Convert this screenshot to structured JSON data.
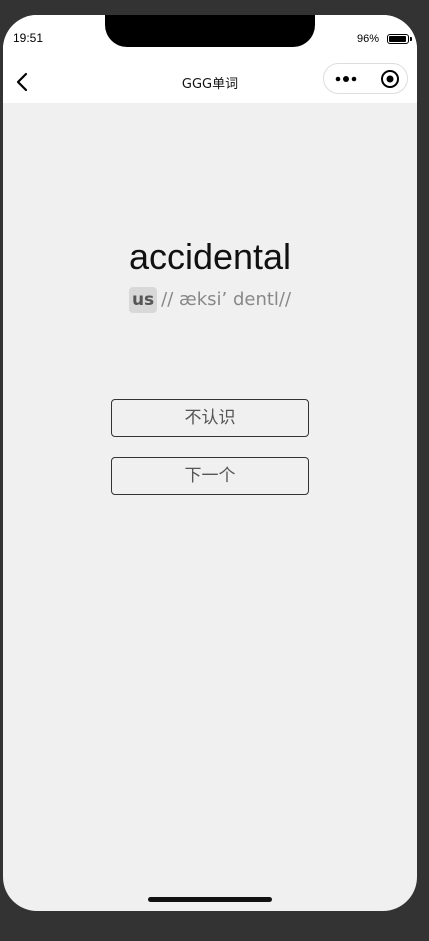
{
  "status_bar": {
    "time": "19:51",
    "battery_percent": "96%",
    "battery_level": 0.96
  },
  "nav": {
    "title": "GGG单词",
    "back_icon": "chevron-left-icon",
    "more_icon": "more-dots-icon",
    "close_icon": "target-circle-icon"
  },
  "card": {
    "word": "accidental",
    "region_label": "us",
    "phonetic": "// æksi’ dentl//"
  },
  "buttons": {
    "unknown_label": "不认识",
    "next_label": "下一个"
  }
}
